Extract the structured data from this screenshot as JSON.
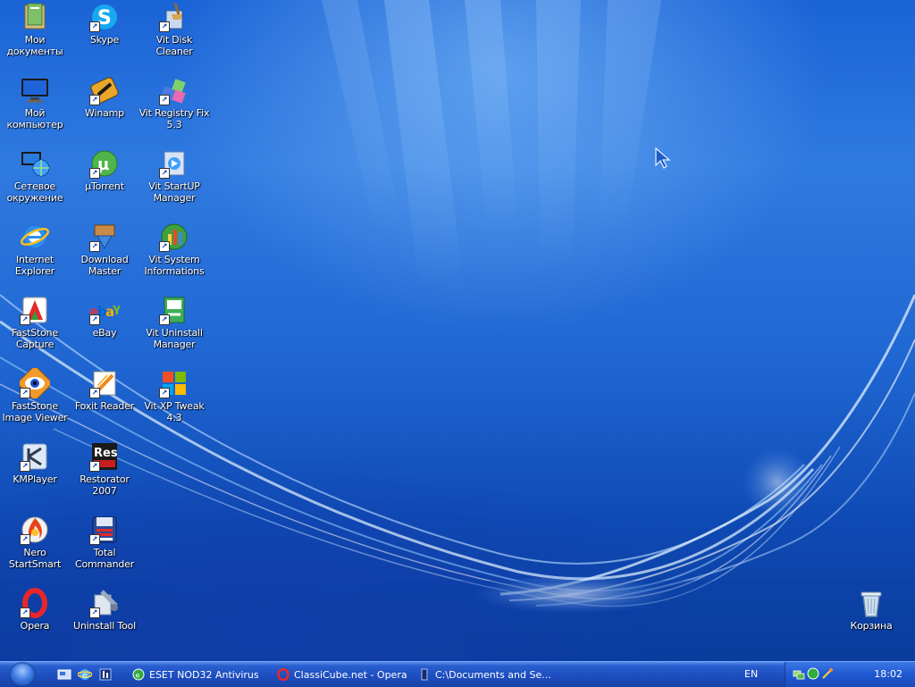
{
  "desktop": {
    "icons": [
      {
        "label": "Мои\nдокументы",
        "icon": "folder-documents-icon"
      },
      {
        "label": "Мой\nкомпьютер",
        "icon": "my-computer-icon"
      },
      {
        "label": "Сетевое\nокружение",
        "icon": "network-icon"
      },
      {
        "label": "Internet\nExplorer",
        "icon": "internet-explorer-icon"
      },
      {
        "label": "FastStone\nCapture",
        "icon": "faststone-capture-icon"
      },
      {
        "label": "FastStone\nImage Viewer",
        "icon": "faststone-viewer-icon"
      },
      {
        "label": "KMPlayer",
        "icon": "kmplayer-icon"
      },
      {
        "label": "Nero\nStartSmart",
        "icon": "nero-icon"
      },
      {
        "label": "Opera",
        "icon": "opera-icon"
      },
      {
        "label": "Skype",
        "icon": "skype-icon"
      },
      {
        "label": "Winamp",
        "icon": "winamp-icon"
      },
      {
        "label": "µTorrent",
        "icon": "utorrent-icon"
      },
      {
        "label": "Download\nMaster",
        "icon": "download-master-icon"
      },
      {
        "label": "eBay",
        "icon": "ebay-icon"
      },
      {
        "label": "Foxit Reader",
        "icon": "foxit-reader-icon"
      },
      {
        "label": "Restorator\n2007",
        "icon": "restorator-icon"
      },
      {
        "label": "Total\nCommander",
        "icon": "total-commander-icon"
      },
      {
        "label": "Uninstall Tool",
        "icon": "uninstall-tool-icon"
      },
      {
        "label": "Vit Disk Cleaner",
        "icon": "vit-disk-cleaner-icon"
      },
      {
        "label": "Vit Registry Fix\n5.3",
        "icon": "vit-registry-fix-icon"
      },
      {
        "label": "Vit StartUP\nManager",
        "icon": "vit-startup-manager-icon"
      },
      {
        "label": "Vit System\nInformations",
        "icon": "vit-system-info-icon"
      },
      {
        "label": "Vit Uninstall\nManager",
        "icon": "vit-uninstall-manager-icon"
      },
      {
        "label": "Vit XP Tweak\n4.3",
        "icon": "vit-xp-tweak-icon"
      },
      {
        "label": "Корзина",
        "icon": "recycle-bin-icon"
      }
    ]
  },
  "taskbar": {
    "tasks": [
      {
        "label": "ESET NOD32 Antivirus",
        "icon": "eset-icon"
      },
      {
        "label": "ClassiCube.net - Opera",
        "icon": "opera-icon"
      },
      {
        "label": "C:\\Documents and Se...",
        "icon": "folder-icon"
      }
    ],
    "language": "EN",
    "clock": "18:02"
  },
  "colors": {
    "accent": "#1c4cbd",
    "wallpaper": "#1a63d6"
  }
}
